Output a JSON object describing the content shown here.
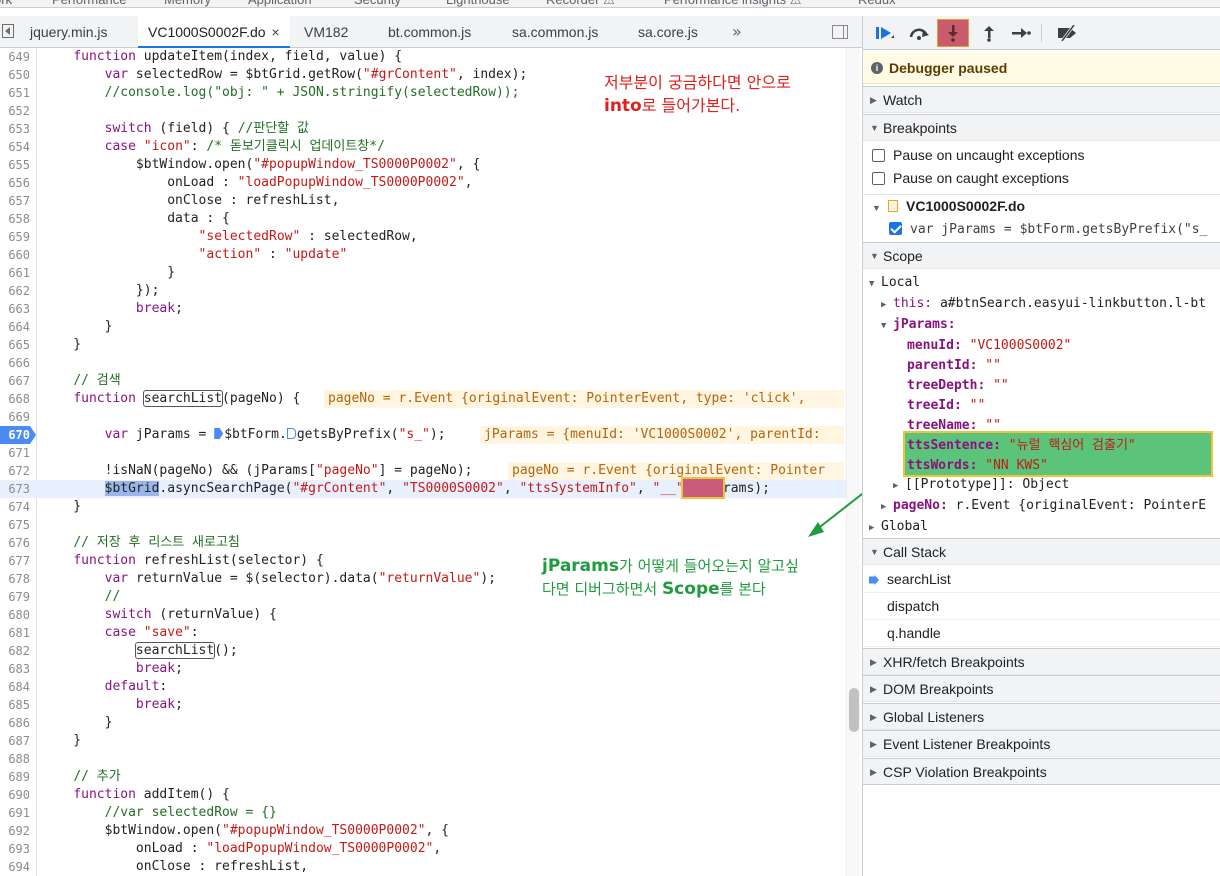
{
  "top_tabs": [
    "ork",
    "Performance",
    "Memory",
    "Application",
    "Security",
    "Lighthouse",
    "Recorder ⚠",
    "Performance insights ⚠",
    "Redux"
  ],
  "file_tabs": [
    {
      "label": "jquery.min.js"
    },
    {
      "label": "VC1000S0002F.do",
      "active": true,
      "close": "×"
    },
    {
      "label": "VM182"
    },
    {
      "label": "bt.common.js"
    },
    {
      "label": "sa.common.js"
    },
    {
      "label": "sa.core.js"
    }
  ],
  "more_tabs": "»",
  "code_lines": [
    {
      "n": "649",
      "t": "    function updateItem(index, field, value) {"
    },
    {
      "n": "650",
      "t": "        var selectedRow = $btGrid.getRow(\"#grContent\", index);"
    },
    {
      "n": "651",
      "t": "        //console.log(\"obj: \" + JSON.stringify(selectedRow));"
    },
    {
      "n": "652",
      "t": ""
    },
    {
      "n": "653",
      "t": "        switch (field) { //판단할 값"
    },
    {
      "n": "654",
      "t": "        case \"icon\": /* 돋보기클릭시 업데이트창*/"
    },
    {
      "n": "655",
      "t": "            $btWindow.open(\"#popupWindow_TS0000P0002\", {"
    },
    {
      "n": "656",
      "t": "                onLoad : \"loadPopupWindow_TS0000P0002\","
    },
    {
      "n": "657",
      "t": "                onClose : refreshList,"
    },
    {
      "n": "658",
      "t": "                data : {"
    },
    {
      "n": "659",
      "t": "                    \"selectedRow\" : selectedRow,"
    },
    {
      "n": "660",
      "t": "                    \"action\" : \"update\""
    },
    {
      "n": "661",
      "t": "                }"
    },
    {
      "n": "662",
      "t": "            });"
    },
    {
      "n": "663",
      "t": "            break;"
    },
    {
      "n": "664",
      "t": "        }"
    },
    {
      "n": "665",
      "t": "    }"
    },
    {
      "n": "666",
      "t": ""
    },
    {
      "n": "667",
      "t": "    // 검색"
    },
    {
      "n": "668",
      "t": "    function searchList(pageNo) {"
    },
    {
      "n": "669",
      "t": ""
    },
    {
      "n": "670",
      "t": "        var jParams = $btForm.getsByPrefix(\"s_\");"
    },
    {
      "n": "671",
      "t": ""
    },
    {
      "n": "672",
      "t": "        !isNaN(pageNo) && (jParams[\"pageNo\"] = pageNo);"
    },
    {
      "n": "673",
      "t": "        $btGrid.asyncSearchPage(\"#grContent\", \"TS0000S0002\", \"ttsSystemInfo\", \"__\", jParams);"
    },
    {
      "n": "674",
      "t": "    }"
    },
    {
      "n": "675",
      "t": ""
    },
    {
      "n": "676",
      "t": "    // 저장 후 리스트 새로고침"
    },
    {
      "n": "677",
      "t": "    function refreshList(selector) {"
    },
    {
      "n": "678",
      "t": "        var returnValue = $(selector).data(\"returnValue\");"
    },
    {
      "n": "679",
      "t": "        //"
    },
    {
      "n": "680",
      "t": "        switch (returnValue) {"
    },
    {
      "n": "681",
      "t": "        case \"save\":"
    },
    {
      "n": "682",
      "t": "            searchList();"
    },
    {
      "n": "683",
      "t": "            break;"
    },
    {
      "n": "684",
      "t": "        default:"
    },
    {
      "n": "685",
      "t": "            break;"
    },
    {
      "n": "686",
      "t": "        }"
    },
    {
      "n": "687",
      "t": "    }"
    },
    {
      "n": "688",
      "t": ""
    },
    {
      "n": "689",
      "t": "    // 추가"
    },
    {
      "n": "690",
      "t": "    function addItem() {"
    },
    {
      "n": "691",
      "t": "        //var selectedRow = {}"
    },
    {
      "n": "692",
      "t": "        $btWindow.open(\"#popupWindow_TS0000P0002\", {"
    },
    {
      "n": "693",
      "t": "            onLoad : \"loadPopupWindow_TS0000P0002\","
    },
    {
      "n": "694",
      "t": "            onClose : refreshList,"
    }
  ],
  "inline_values": {
    "line668": "pageNo = r.Event {originalEvent: PointerEvent, type: 'click', ",
    "line670": "jParams = {menuId: 'VC1000S0002', parentId:",
    "line672": "pageNo = r.Event {originalEvent: Pointer"
  },
  "annotations": {
    "red_line1": "저부분이 궁금하다면 안으로",
    "red_bold": "into",
    "red_line2_rest": "로 들어가본다.",
    "green_bold1": "jParams",
    "green_line1_rest": "가 어떻게 들어오는지 알고싶",
    "green_line2_pre": "다면 디버그하면서 ",
    "green_bold2": "Scope",
    "green_line2_rest": "를 본다"
  },
  "debugger": {
    "paused": "Debugger paused",
    "sections": {
      "watch": "Watch",
      "breakpoints": "Breakpoints",
      "scope": "Scope",
      "call_stack": "Call Stack",
      "xhr": "XHR/fetch Breakpoints",
      "dom": "DOM Breakpoints",
      "global_listeners": "Global Listeners",
      "event_listener": "Event Listener Breakpoints",
      "csp": "CSP Violation Breakpoints"
    },
    "pause_uncaught": "Pause on uncaught exceptions",
    "pause_caught": "Pause on caught exceptions",
    "bp_file": "VC1000S0002F.do",
    "bp_line": "var jParams = $btForm.getsByPrefix(\"s_",
    "scope": {
      "local": "Local",
      "this_key": "this:",
      "this_val": "a#btnSearch.easyui-linkbutton.l-bt",
      "jparams_key": "jParams:",
      "props": [
        {
          "k": "menuId:",
          "v": "\"VC1000S0002\""
        },
        {
          "k": "parentId:",
          "v": "\"\""
        },
        {
          "k": "treeDepth:",
          "v": "\"\""
        },
        {
          "k": "treeId:",
          "v": "\"\""
        },
        {
          "k": "treeName:",
          "v": "\"\""
        },
        {
          "k": "ttsSentence:",
          "v": "\"뉴럴 핵심어 검출기\""
        },
        {
          "k": "ttsWords:",
          "v": "\"NN KWS\""
        }
      ],
      "prototype": "[[Prototype]]: Object",
      "pageno_key": "pageNo:",
      "pageno_val": "r.Event {originalEvent: PointerE",
      "global": "Global"
    },
    "call_stack": [
      "searchList",
      "dispatch",
      "q.handle"
    ]
  }
}
